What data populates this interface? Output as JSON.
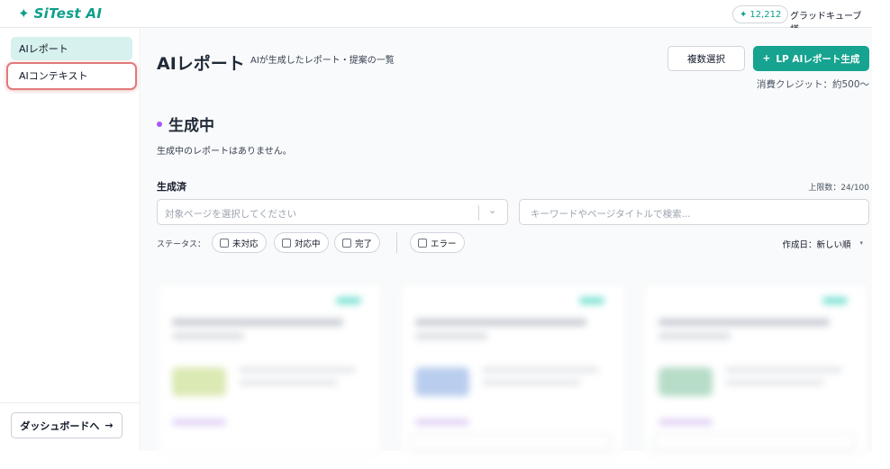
{
  "topbar": {
    "logo_spark": "✦",
    "logo_text": "SiTest AI",
    "credit_icon": "✦",
    "credit_count": "12,212",
    "user_name": "グラッドキューブ 様"
  },
  "sidebar": {
    "items": [
      {
        "label": "AIレポート",
        "active": true
      },
      {
        "label": "AIコンテキスト",
        "active": false
      }
    ],
    "dashboard_label": "ダッシュボードへ",
    "dashboard_arrow": "→"
  },
  "header": {
    "title": "AIレポート",
    "subtitle": "AIが生成したレポート・提案の一覧",
    "multi_select_label": "複数選択",
    "generate_plus": "+",
    "generate_label": "LP AIレポート生成",
    "credit_note": "消費クレジット：約500〜"
  },
  "generating": {
    "title": "生成中",
    "empty_message": "生成中のレポートはありません。"
  },
  "done": {
    "title": "生成済",
    "limit": "上限数：24/100",
    "page_select_placeholder": "対象ページを選択してください",
    "search_placeholder": "キーワードやページタイトルで検索...",
    "status_label": "ステータス：",
    "status_filters": [
      "未対応",
      "対応中",
      "完了"
    ],
    "error_filter": "エラー",
    "sort_label": "作成日：新しい順",
    "sort_caret": "▾"
  },
  "colors": {
    "accent": "#16a38f",
    "brand": "#0e9f8b",
    "active_bg": "#d6f1ee",
    "highlight": "#e07a7a",
    "dot": "#a855f7"
  }
}
